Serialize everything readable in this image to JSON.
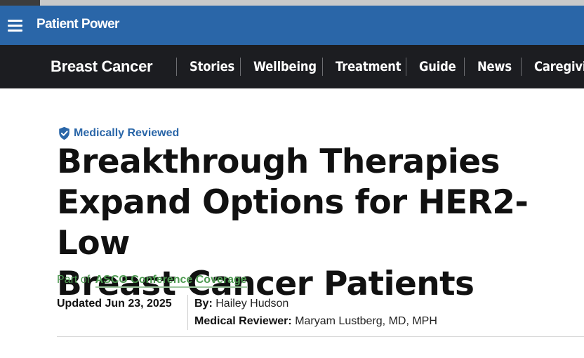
{
  "header": {
    "logo": "Patient Power",
    "menu_icon": "hamburger-menu-icon"
  },
  "nav": {
    "section_title": "Breast Cancer",
    "items": [
      {
        "label": "Stories"
      },
      {
        "label": "Wellbeing"
      },
      {
        "label": "Treatment"
      },
      {
        "label": "Guide"
      },
      {
        "label": "News"
      },
      {
        "label": "Caregivin"
      }
    ]
  },
  "article": {
    "badge": "Medically Reviewed",
    "badge_icon": "shield-check-icon",
    "title_lines": [
      "Breakthrough Therapies",
      "Expand Options for HER2-Low",
      "Breast Cancer Patients"
    ],
    "part_of_prefix": "Part of",
    "part_of_link": "ASCO Conference Coverage",
    "updated": "Updated Jun 23, 2025",
    "by_label": "By:",
    "author": "Hailey Hudson",
    "reviewer_label": "Medical Reviewer:",
    "reviewer": "Maryam Lustberg, MD, MPH"
  },
  "colors": {
    "brand_blue": "#2a66a8",
    "nav_dark": "#1c1d21",
    "link_green": "#4d9a50"
  }
}
